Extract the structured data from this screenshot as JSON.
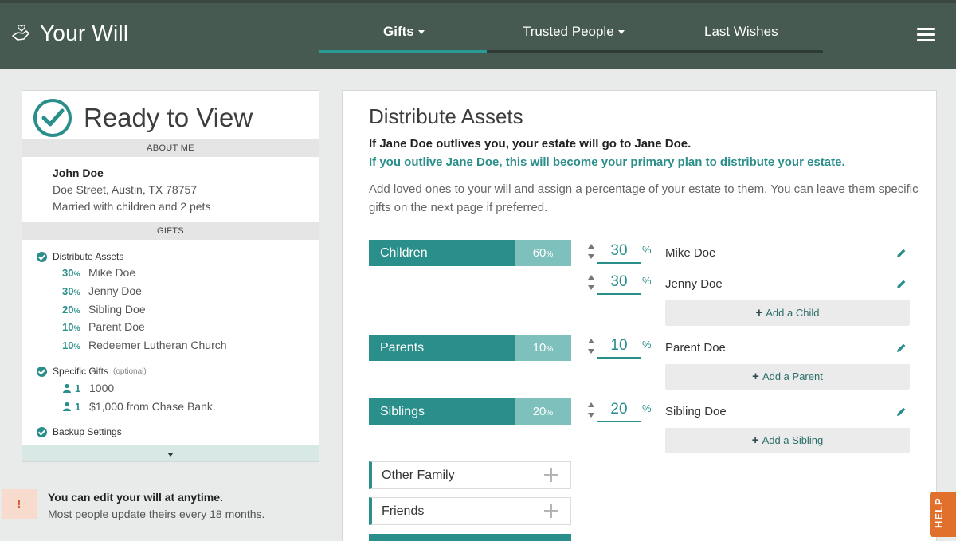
{
  "app": {
    "title": "Your Will"
  },
  "nav": {
    "tabs": [
      {
        "label": "Gifts",
        "active": true,
        "dropdown": true
      },
      {
        "label": "Trusted People",
        "active": false,
        "dropdown": true
      },
      {
        "label": "Last Wishes",
        "active": false,
        "dropdown": false
      }
    ],
    "menu_icon": "hamburger-menu-icon"
  },
  "summary": {
    "status": "Ready to View",
    "about_header": "ABOUT ME",
    "name": "John Doe",
    "address": "Doe Street, Austin, TX 78757",
    "family": "Married with children and 2 pets",
    "gifts_header": "GIFTS",
    "distribute_title": "Distribute Assets",
    "allocations": [
      {
        "pct": "30",
        "name": "Mike Doe"
      },
      {
        "pct": "30",
        "name": "Jenny Doe"
      },
      {
        "pct": "20",
        "name": "Sibling Doe"
      },
      {
        "pct": "10",
        "name": "Parent Doe"
      },
      {
        "pct": "10",
        "name": "Redeemer Lutheran Church"
      }
    ],
    "specific_title": "Specific Gifts",
    "specific_optional": "(optional)",
    "specific_items": [
      {
        "count": "1",
        "text": "1000"
      },
      {
        "count": "1",
        "text": "$1,000 from Chase Bank."
      }
    ],
    "backup_title": "Backup Settings",
    "pct_symbol": "%"
  },
  "notice": {
    "icon": "!",
    "title": "You can edit your will at anytime.",
    "subtitle": "Most people update theirs every 18 months."
  },
  "main": {
    "title": "Distribute Assets",
    "line_bold": "If Jane Doe outlives you, your estate will go to Jane Doe.",
    "line_teal": "If you outlive Jane Doe, this will become your primary plan to distribute your estate.",
    "description": "Add loved ones to your will and assign a percentage of your estate to them. You can leave them specific gifts on the next page if preferred.",
    "pct_symbol": "%",
    "groups": [
      {
        "label": "Children",
        "pct": "60",
        "people": [
          {
            "pct": "30",
            "name": "Mike Doe"
          },
          {
            "pct": "30",
            "name": "Jenny Doe"
          }
        ],
        "add_label": "Add a Child"
      },
      {
        "label": "Parents",
        "pct": "10",
        "people": [
          {
            "pct": "10",
            "name": "Parent Doe"
          }
        ],
        "add_label": "Add a Parent"
      },
      {
        "label": "Siblings",
        "pct": "20",
        "people": [
          {
            "pct": "20",
            "name": "Sibling Doe"
          }
        ],
        "add_label": "Add a Sibling"
      }
    ],
    "collapsed_groups": [
      {
        "label": "Other Family"
      },
      {
        "label": "Friends"
      }
    ]
  },
  "help": {
    "label": "HELP"
  },
  "colors": {
    "accent": "#2a8e8a",
    "header": "#465a52",
    "help": "#e0702c"
  }
}
